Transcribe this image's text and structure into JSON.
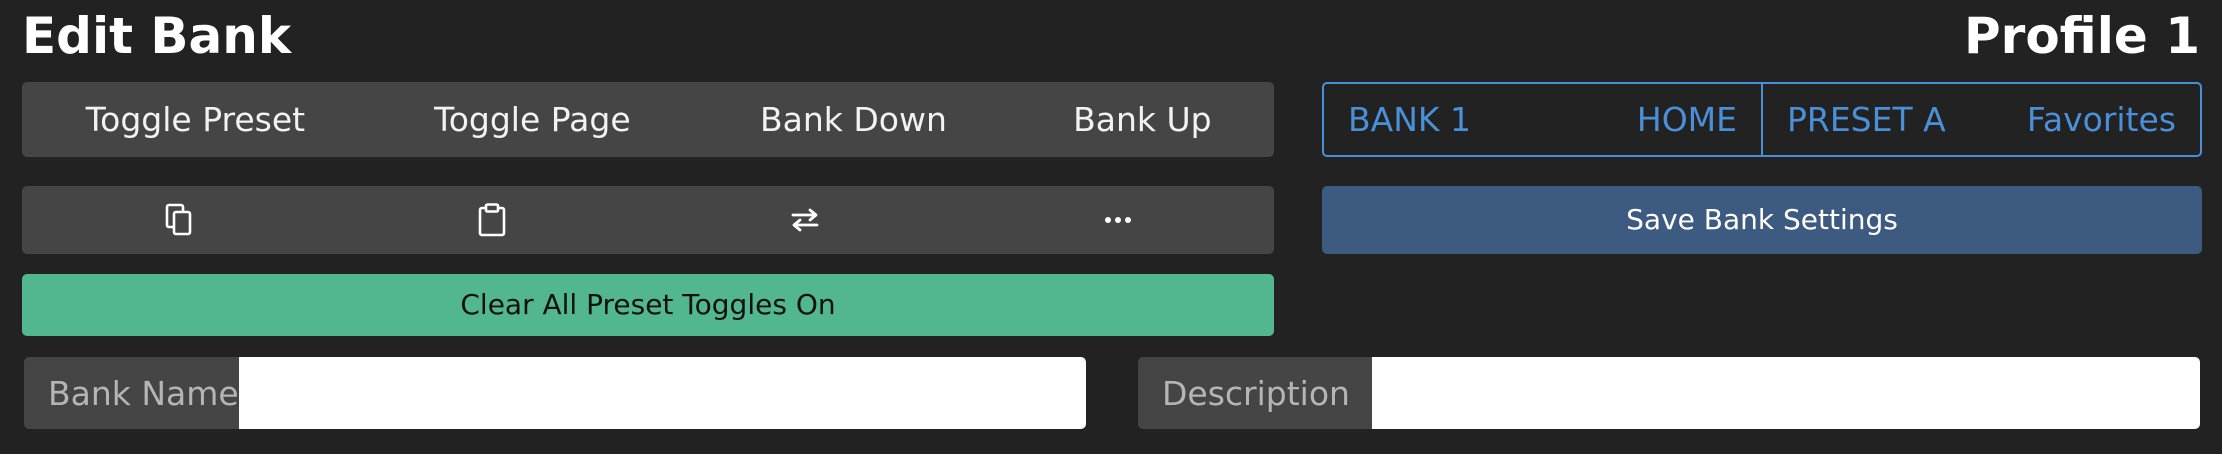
{
  "header": {
    "title": "Edit Bank",
    "profile": "Profile 1"
  },
  "nav": {
    "toggle_preset": "Toggle Preset",
    "toggle_page": "Toggle Page",
    "bank_down": "Bank Down",
    "bank_up": "Bank Up"
  },
  "toolbar": {
    "icons": [
      "copy-icon",
      "paste-icon",
      "swap-icon",
      "more-icon"
    ]
  },
  "clear_button": "Clear All Preset Toggles On",
  "status": {
    "bank": "BANK 1",
    "home": "HOME",
    "preset": "PRESET A",
    "favorites": "Favorites"
  },
  "save_button": "Save Bank Settings",
  "fields": {
    "bank_name_label": "Bank Name",
    "bank_name_value": "",
    "description_label": "Description",
    "description_value": ""
  },
  "colors": {
    "background": "#222222",
    "button": "#454545",
    "accent_green": "#52b78e",
    "accent_blue": "#4a90d9",
    "save_blue": "#3d5a80"
  }
}
